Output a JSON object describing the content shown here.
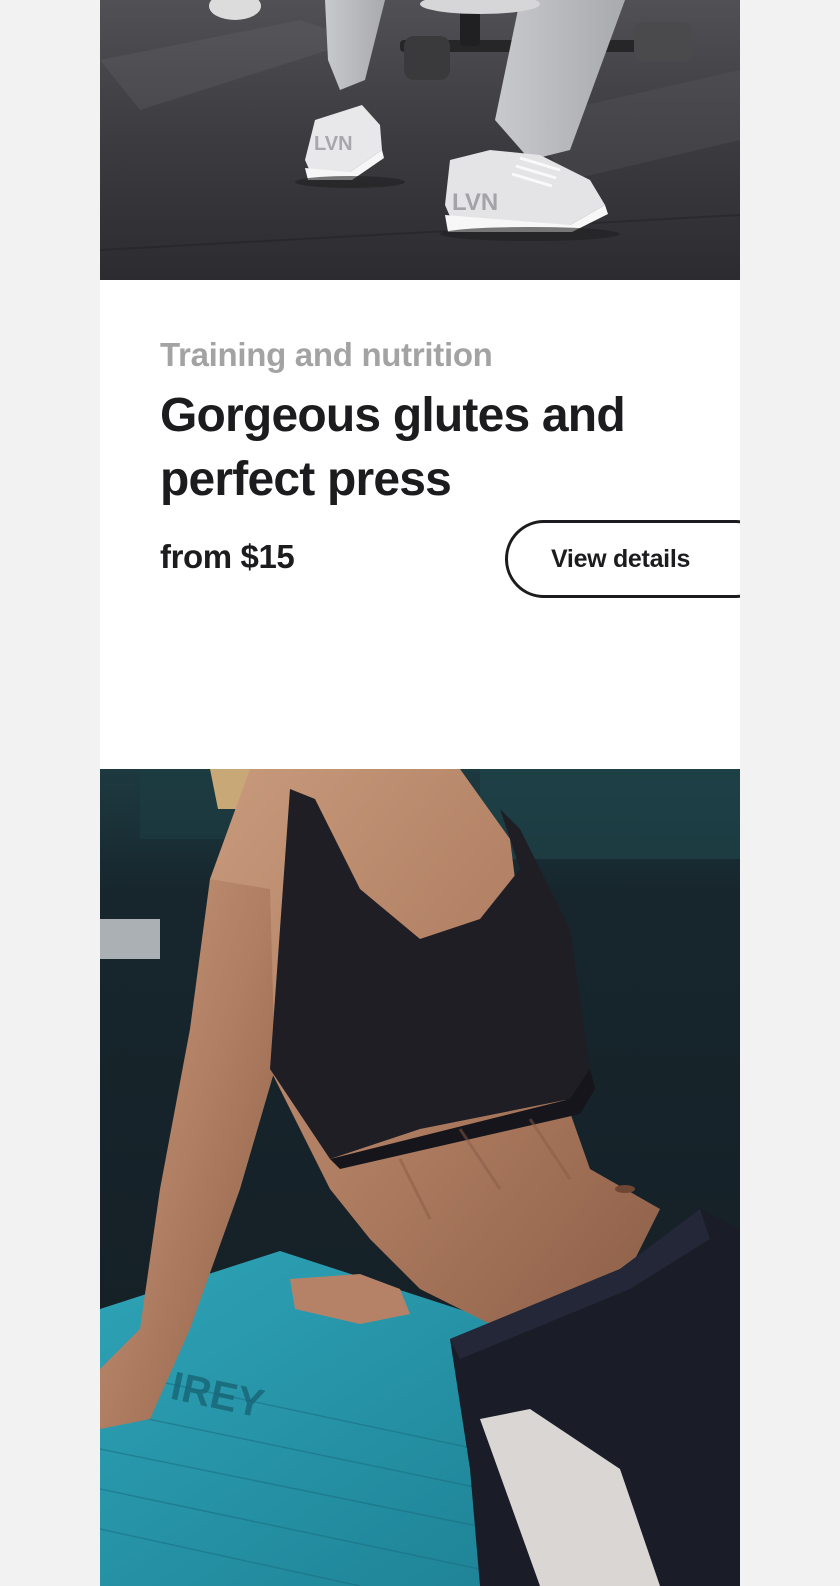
{
  "images": {
    "top": {
      "name": "Gym floor with white sneakers and dumbbell"
    },
    "bottom": {
      "name": "Woman in sports bra on teal yoga mat"
    }
  },
  "card": {
    "category": "Training and nutrition",
    "title": "Gorgeous glutes and perfect press",
    "price": "from $15",
    "cta_label": "View details"
  },
  "colors": {
    "page_background": "#f2f2f2",
    "card_background": "#ffffff",
    "category_text": "#a3a3a3",
    "primary_text": "#1c1c1e",
    "button_border": "#1c1c1e"
  }
}
